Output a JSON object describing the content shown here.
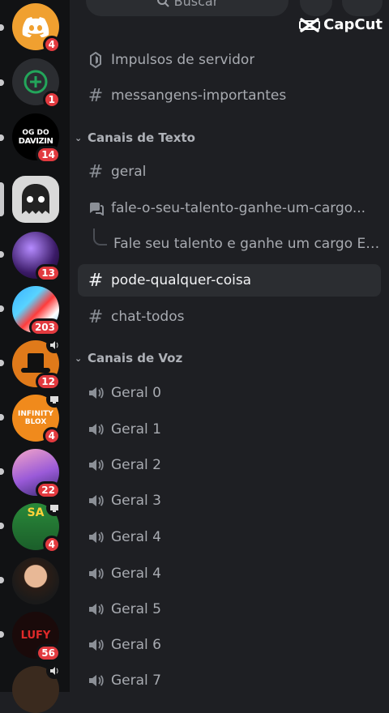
{
  "search": {
    "label": "Buscar"
  },
  "watermark": {
    "text": "CapCut"
  },
  "servers": [
    {
      "id": "discord",
      "badge": "4",
      "color": "#f0a030"
    },
    {
      "id": "add",
      "badge": "1",
      "color": "#2f3136"
    },
    {
      "id": "og-do-davizin",
      "label_top": "OG DO",
      "label_bottom": "DAVIZIN",
      "badge": "14"
    },
    {
      "id": "ghost-server",
      "badge": ""
    },
    {
      "id": "purple-anime",
      "badge": "13"
    },
    {
      "id": "colorful",
      "badge": "203"
    },
    {
      "id": "hat-server",
      "badge": "12",
      "status_icon": "speaker-icon"
    },
    {
      "id": "infinity-blox",
      "label": "INFINITY BLOX",
      "badge": "4",
      "status_icon": "screen-icon"
    },
    {
      "id": "anime-girl",
      "badge": "22"
    },
    {
      "id": "sa-server",
      "label": "SA",
      "badge": "4",
      "status_icon": "screen-icon"
    },
    {
      "id": "person",
      "badge": ""
    },
    {
      "id": "luffy",
      "label": "LUFY",
      "badge": "56"
    },
    {
      "id": "bottom-server",
      "badge": "",
      "status_icon": "speaker-icon"
    }
  ],
  "channels": {
    "top": [
      {
        "icon": "boost-icon",
        "label": "Impulsos de servidor"
      },
      {
        "icon": "hash-icon",
        "label": "messangens-importantes"
      }
    ],
    "text_category": "Canais de Texto",
    "text": [
      {
        "icon": "hash-icon",
        "label": "geral"
      },
      {
        "icon": "forum-icon",
        "label": "fale-o-seu-talento-ganhe-um-cargo..."
      },
      {
        "icon": "thread-icon",
        "label": "Fale seu talento e ganhe um cargo EX..."
      },
      {
        "icon": "hash-icon",
        "label": "pode-qualquer-coisa",
        "active": true
      },
      {
        "icon": "hash-icon",
        "label": "chat-todos"
      }
    ],
    "voice_category": "Canais de Voz",
    "voice": [
      {
        "icon": "speaker-icon",
        "label": "Geral 0"
      },
      {
        "icon": "speaker-icon",
        "label": "Geral 1"
      },
      {
        "icon": "speaker-icon",
        "label": "Geral 2"
      },
      {
        "icon": "speaker-icon",
        "label": "Geral 3"
      },
      {
        "icon": "speaker-icon",
        "label": "Geral 4"
      },
      {
        "icon": "speaker-icon",
        "label": "Geral 4"
      },
      {
        "icon": "speaker-icon",
        "label": "Geral 5"
      },
      {
        "icon": "speaker-icon",
        "label": "Geral 6"
      },
      {
        "icon": "speaker-icon",
        "label": "Geral 7"
      }
    ]
  }
}
